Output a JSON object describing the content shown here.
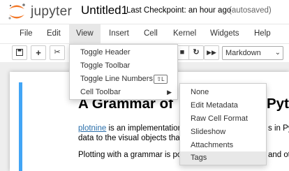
{
  "header": {
    "logo_text": "jupyter",
    "notebook_name": "Untitled1",
    "checkpoint": "Last Checkpoint: an hour ago",
    "autosave": "(autosaved)"
  },
  "menubar": [
    "File",
    "Edit",
    "View",
    "Insert",
    "Cell",
    "Kernel",
    "Widgets",
    "Help"
  ],
  "toolbar": {
    "buttons": [
      "save-icon",
      "plus-icon",
      "scissors-icon",
      "stop-icon",
      "restart-icon",
      "fast-forward-icon"
    ],
    "cell_type": "Markdown"
  },
  "view_menu": {
    "items": [
      "Toggle Header",
      "Toggle Toolbar",
      "Toggle Line Numbers",
      "Cell Toolbar"
    ],
    "line_numbers_shortcut": "⇧L"
  },
  "cell_toolbar_menu": {
    "items": [
      "None",
      "Edit Metadata",
      "Raw Cell Format",
      "Slideshow",
      "Attachments",
      "Tags"
    ]
  },
  "cell": {
    "heading": "A Grammar of",
    "heading_tail": "Pyt",
    "p1_link": "plotnine",
    "p1_text": " is an implementation",
    "p1_tail": "s in Py",
    "p2_text": "data to the visual objects that",
    "p3_text": "Plotting with a grammar is po",
    "p3_tail": "and ot"
  }
}
